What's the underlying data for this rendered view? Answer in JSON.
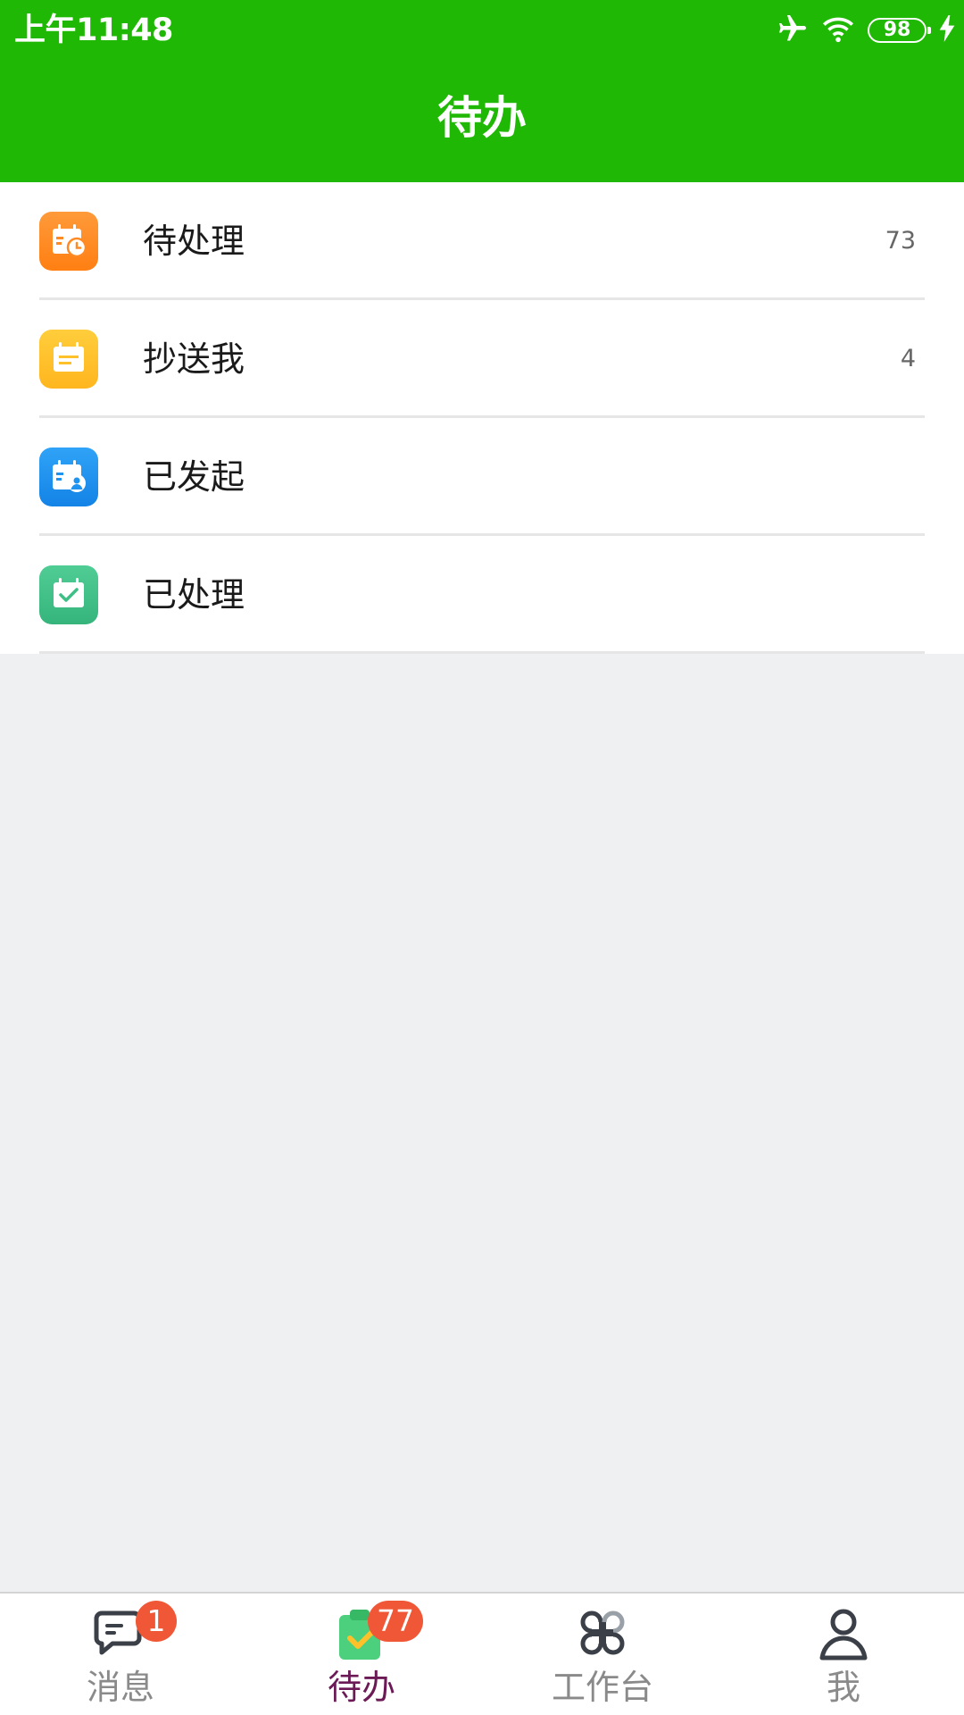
{
  "status_bar": {
    "time": "上午11:48",
    "battery": "98",
    "icons": [
      "airplane-icon",
      "wifi-icon",
      "battery-icon",
      "charging-icon"
    ]
  },
  "header": {
    "title": "待办",
    "background": "#1fb905"
  },
  "list": {
    "items": [
      {
        "label": "待处理",
        "count": "73",
        "icon": "calendar-clock-icon",
        "color": "#ff8a23"
      },
      {
        "label": "抄送我",
        "count": "4",
        "icon": "calendar-list-icon",
        "color": "#ffc12a"
      },
      {
        "label": "已发起",
        "count": "",
        "icon": "calendar-person-icon",
        "color": "#1e93f0"
      },
      {
        "label": "已处理",
        "count": "",
        "icon": "calendar-check-icon",
        "color": "#3dbf86"
      }
    ]
  },
  "tabbar": {
    "tabs": [
      {
        "label": "消息",
        "badge": "1",
        "icon": "chat-bubble-icon",
        "active": false
      },
      {
        "label": "待办",
        "badge": "77",
        "icon": "clipboard-check-icon",
        "active": true
      },
      {
        "label": "工作台",
        "badge": "",
        "icon": "command-icon",
        "active": false
      },
      {
        "label": "我",
        "badge": "",
        "icon": "person-icon",
        "active": false
      }
    ],
    "active_color": "#6b1a55",
    "badge_color": "#ef5736"
  }
}
